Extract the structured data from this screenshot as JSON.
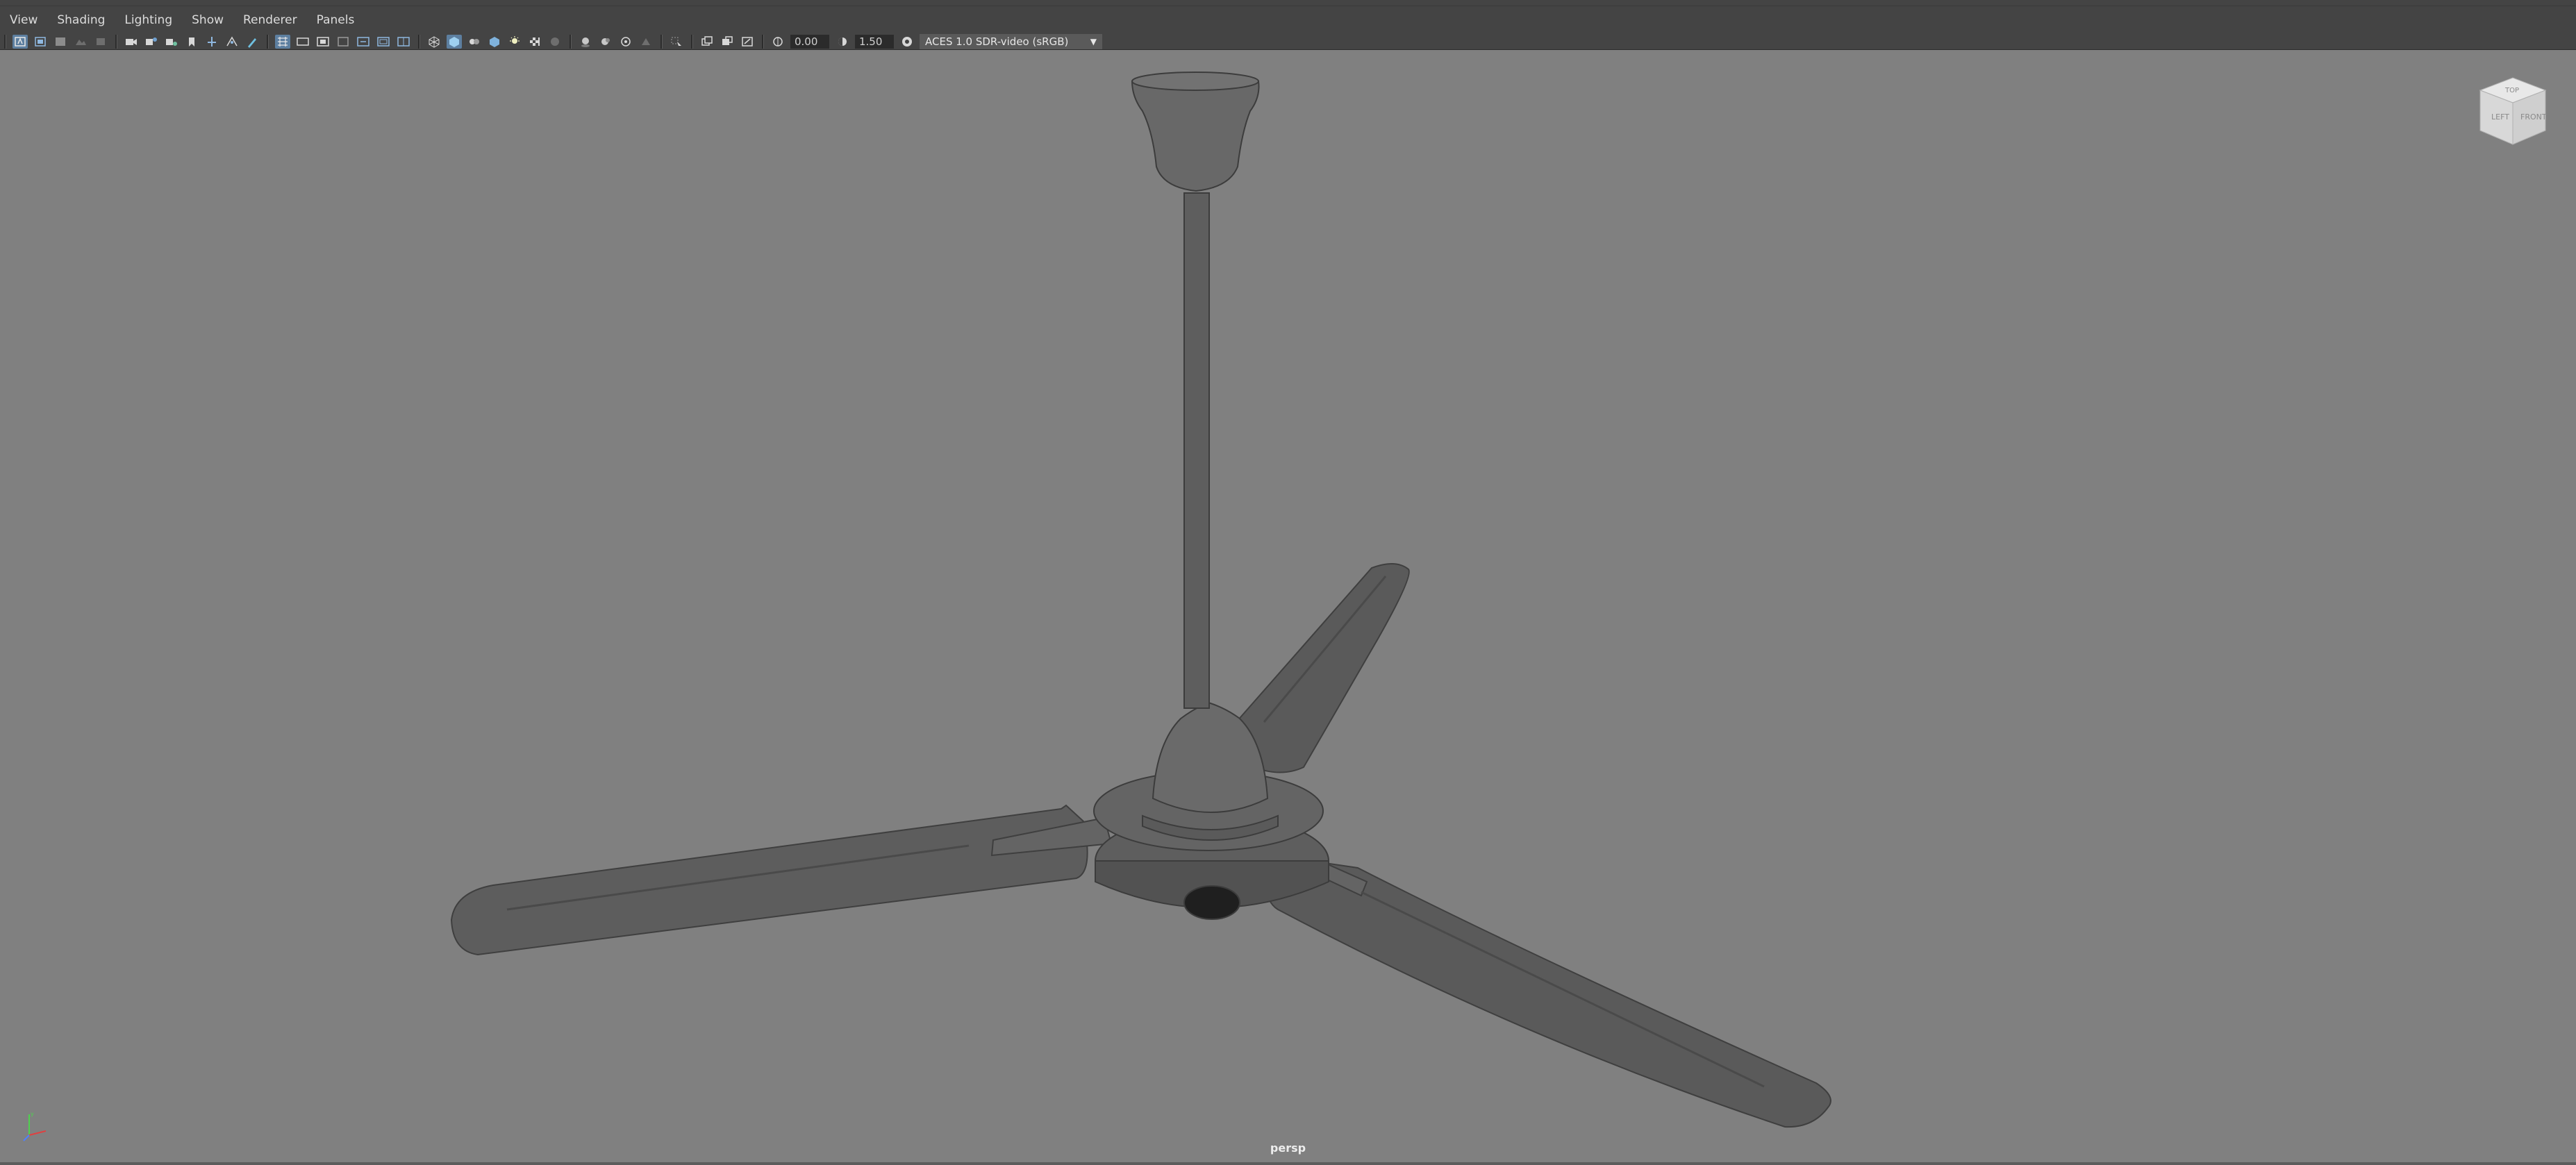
{
  "menubar": {
    "items": [
      {
        "label": "View"
      },
      {
        "label": "Shading"
      },
      {
        "label": "Lighting"
      },
      {
        "label": "Show"
      },
      {
        "label": "Renderer"
      },
      {
        "label": "Panels"
      }
    ]
  },
  "toolbar": {
    "exposure_value": "0.00",
    "gamma_value": "1.50",
    "color_space": "ACES 1.0 SDR-video (sRGB)",
    "icons": [
      "select-camera-icon",
      "camera-attributes-icon",
      "bookmarks-icon",
      "image-plane-icon",
      "grid-2d-pan-icon",
      "grease-pencil-icon",
      "camera-icon",
      "camera-lock-icon",
      "camera-bookmark-icon",
      "bookmark-icon",
      "snap-icon",
      "transform-icon",
      "paint-icon",
      "grid-icon",
      "film-gate-icon",
      "resolution-gate-icon",
      "gate-mask-icon",
      "field-chart-icon",
      "safe-action-icon",
      "safe-title-icon",
      "wireframe-icon",
      "smooth-shade-icon",
      "wireframe-on-shaded-icon",
      "textured-icon",
      "lights-icon",
      "shadows-icon",
      "ambient-occlusion-icon",
      "motion-blur-icon",
      "anti-aliasing-icon",
      "depth-of-field-icon",
      "isolate-select-icon",
      "xray-icon",
      "xray-joints-icon",
      "xray-components-icon"
    ]
  },
  "view_cube": {
    "faces": [
      "LEFT",
      "FRONT",
      "TOP"
    ]
  },
  "viewport": {
    "camera_label": "persp"
  },
  "colors": {
    "background": "#808080",
    "panel": "#444444",
    "accent": "#5d7fa0",
    "model": "#5a5a5a"
  }
}
